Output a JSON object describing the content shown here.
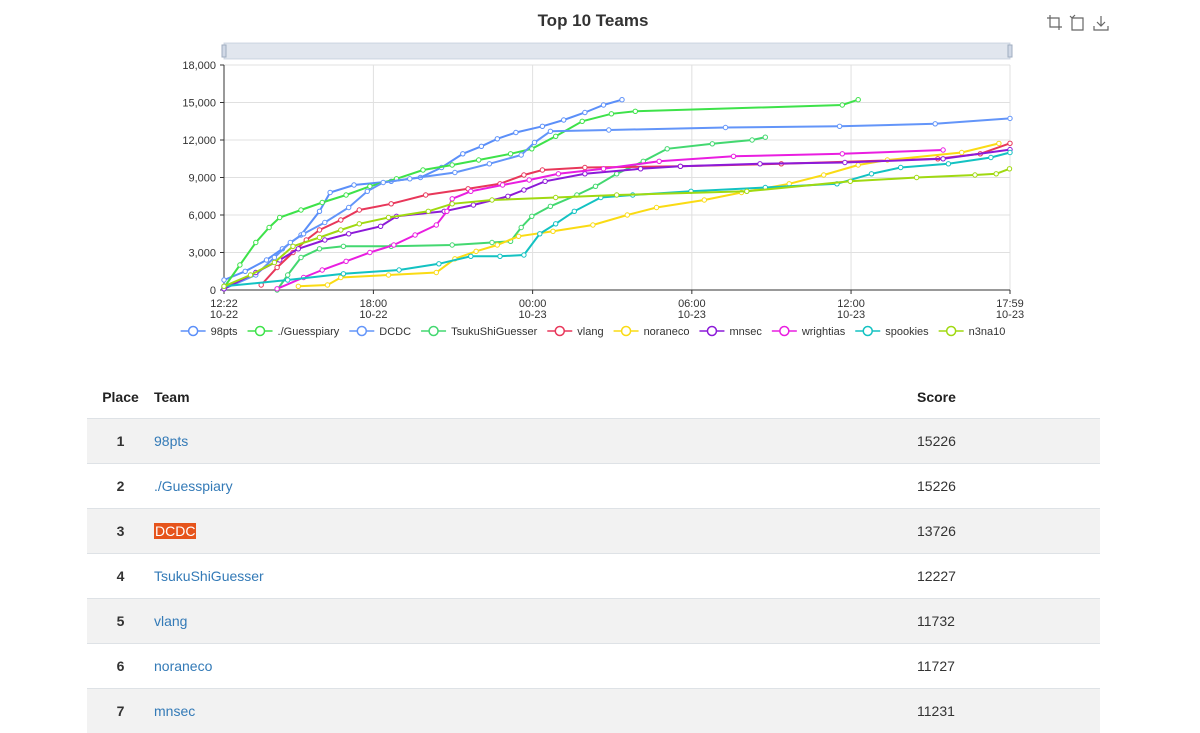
{
  "toolbar": {
    "zoom_icon": "zoom-icon",
    "zoom_reset_icon": "zoom-reset-icon",
    "download_icon": "download-icon"
  },
  "chart_data": {
    "type": "line",
    "title": "Top 10 Teams",
    "ylim": [
      0,
      18000
    ],
    "yticks": [
      0,
      3000,
      6000,
      9000,
      12000,
      15000,
      18000
    ],
    "ytick_labels": [
      "0",
      "3,000",
      "6,000",
      "9,000",
      "12,000",
      "15,000",
      "18,000"
    ],
    "xlim_hours": [
      0,
      29.62
    ],
    "xticks": [
      {
        "h": 0,
        "time": "12:22",
        "date": "10-22"
      },
      {
        "h": 5.63,
        "time": "18:00",
        "date": "10-22"
      },
      {
        "h": 11.63,
        "time": "00:00",
        "date": "10-23"
      },
      {
        "h": 17.63,
        "time": "06:00",
        "date": "10-23"
      },
      {
        "h": 23.63,
        "time": "12:00",
        "date": "10-23"
      },
      {
        "h": 29.62,
        "time": "17:59",
        "date": "10-23"
      }
    ],
    "grid": true,
    "legend_position": "bottom",
    "series": [
      {
        "name": "98pts",
        "color": "#5b8ff9",
        "points": [
          [
            0,
            800
          ],
          [
            0.8,
            1500
          ],
          [
            1.6,
            2400
          ],
          [
            2.2,
            3300
          ],
          [
            2.9,
            4400
          ],
          [
            3.6,
            6300
          ],
          [
            4,
            7800
          ],
          [
            4.9,
            8400
          ],
          [
            6.3,
            8700
          ],
          [
            7.4,
            9000
          ],
          [
            8.2,
            9800
          ],
          [
            9,
            10900
          ],
          [
            9.7,
            11500
          ],
          [
            10.3,
            12100
          ],
          [
            11,
            12600
          ],
          [
            12,
            13100
          ],
          [
            12.8,
            13600
          ],
          [
            13.6,
            14200
          ],
          [
            14.3,
            14800
          ],
          [
            15,
            15226
          ]
        ]
      },
      {
        "name": "./Guesspiary",
        "color": "#3ee24a",
        "points": [
          [
            0,
            200
          ],
          [
            0.6,
            2000
          ],
          [
            1.2,
            3800
          ],
          [
            1.7,
            5000
          ],
          [
            2.1,
            5800
          ],
          [
            2.9,
            6400
          ],
          [
            3.7,
            7000
          ],
          [
            4.6,
            7600
          ],
          [
            5.5,
            8300
          ],
          [
            6.5,
            8900
          ],
          [
            7.5,
            9600
          ],
          [
            8.6,
            10000
          ],
          [
            9.6,
            10400
          ],
          [
            10.8,
            10900
          ],
          [
            11.6,
            11300
          ],
          [
            12.5,
            12300
          ],
          [
            13.5,
            13500
          ],
          [
            14.6,
            14100
          ],
          [
            15.5,
            14300
          ],
          [
            23.3,
            14800
          ],
          [
            23.9,
            15226
          ]
        ]
      },
      {
        "name": "DCDC",
        "color": "#6395f9",
        "points": [
          [
            0,
            100
          ],
          [
            1.2,
            1200
          ],
          [
            1.9,
            2600
          ],
          [
            2.5,
            3800
          ],
          [
            3,
            4500
          ],
          [
            3.8,
            5400
          ],
          [
            4.7,
            6600
          ],
          [
            5.4,
            7900
          ],
          [
            6,
            8600
          ],
          [
            7,
            8900
          ],
          [
            8.7,
            9400
          ],
          [
            10,
            10100
          ],
          [
            11.2,
            10800
          ],
          [
            11.7,
            11800
          ],
          [
            12.3,
            12700
          ],
          [
            14.5,
            12800
          ],
          [
            18.9,
            13000
          ],
          [
            23.2,
            13100
          ],
          [
            26.8,
            13300
          ],
          [
            29.62,
            13726
          ]
        ]
      },
      {
        "name": "TsukuShiGuesser",
        "color": "#43d870",
        "points": [
          [
            2,
            0
          ],
          [
            2.4,
            1200
          ],
          [
            2.9,
            2600
          ],
          [
            3.6,
            3300
          ],
          [
            4.5,
            3500
          ],
          [
            6.3,
            3500
          ],
          [
            8.6,
            3600
          ],
          [
            10.1,
            3800
          ],
          [
            10.8,
            3900
          ],
          [
            11.2,
            5000
          ],
          [
            11.6,
            5900
          ],
          [
            12.3,
            6700
          ],
          [
            13.3,
            7600
          ],
          [
            14,
            8300
          ],
          [
            14.8,
            9300
          ],
          [
            15.8,
            10300
          ],
          [
            16.7,
            11300
          ],
          [
            18.4,
            11700
          ],
          [
            19.9,
            12000
          ],
          [
            20.4,
            12227
          ]
        ]
      },
      {
        "name": "vlang",
        "color": "#e8375a",
        "points": [
          [
            1.4,
            400
          ],
          [
            2,
            1800
          ],
          [
            2.6,
            3000
          ],
          [
            3.1,
            4000
          ],
          [
            3.6,
            4800
          ],
          [
            4.4,
            5600
          ],
          [
            5.1,
            6400
          ],
          [
            6.3,
            6900
          ],
          [
            7.6,
            7600
          ],
          [
            9.2,
            8100
          ],
          [
            10.4,
            8500
          ],
          [
            11.3,
            9200
          ],
          [
            12,
            9600
          ],
          [
            13.6,
            9800
          ],
          [
            17.2,
            9900
          ],
          [
            21,
            10100
          ],
          [
            26.9,
            10500
          ],
          [
            28.5,
            10900
          ],
          [
            29.62,
            11732
          ]
        ]
      },
      {
        "name": "noraneco",
        "color": "#fadb14",
        "points": [
          [
            2.8,
            300
          ],
          [
            3.9,
            400
          ],
          [
            4.4,
            1000
          ],
          [
            6.2,
            1200
          ],
          [
            8,
            1400
          ],
          [
            8.7,
            2500
          ],
          [
            9.5,
            3100
          ],
          [
            10.3,
            3600
          ],
          [
            11.1,
            4300
          ],
          [
            12.4,
            4700
          ],
          [
            13.9,
            5200
          ],
          [
            15.2,
            6000
          ],
          [
            16.3,
            6600
          ],
          [
            18.1,
            7200
          ],
          [
            19.5,
            7800
          ],
          [
            21.3,
            8500
          ],
          [
            22.6,
            9200
          ],
          [
            23.9,
            10000
          ],
          [
            25,
            10400
          ],
          [
            27.8,
            11000
          ],
          [
            29.2,
            11727
          ]
        ]
      },
      {
        "name": "mnsec",
        "color": "#8c1ad8",
        "points": [
          [
            0,
            100
          ],
          [
            1.2,
            1400
          ],
          [
            2.1,
            2400
          ],
          [
            2.8,
            3300
          ],
          [
            3.8,
            4000
          ],
          [
            4.7,
            4500
          ],
          [
            5.9,
            5100
          ],
          [
            6.5,
            5900
          ],
          [
            8.3,
            6300
          ],
          [
            9.4,
            6800
          ],
          [
            10.7,
            7500
          ],
          [
            11.3,
            8000
          ],
          [
            12.1,
            8700
          ],
          [
            13.6,
            9300
          ],
          [
            15.7,
            9700
          ],
          [
            17.2,
            9900
          ],
          [
            20.2,
            10100
          ],
          [
            23.4,
            10200
          ],
          [
            27.1,
            10500
          ],
          [
            29.62,
            11231
          ]
        ]
      },
      {
        "name": "wrightias",
        "color": "#e91ee0",
        "points": [
          [
            2,
            100
          ],
          [
            3,
            1000
          ],
          [
            3.7,
            1600
          ],
          [
            4.6,
            2300
          ],
          [
            5.5,
            3000
          ],
          [
            6.4,
            3600
          ],
          [
            7.2,
            4400
          ],
          [
            8,
            5200
          ],
          [
            8.4,
            6300
          ],
          [
            8.6,
            7300
          ],
          [
            9.3,
            7900
          ],
          [
            10.5,
            8400
          ],
          [
            11.5,
            8800
          ],
          [
            12.6,
            9300
          ],
          [
            14.3,
            9700
          ],
          [
            16.4,
            10300
          ],
          [
            19.2,
            10700
          ],
          [
            23.3,
            10900
          ],
          [
            27.1,
            11200
          ]
        ]
      },
      {
        "name": "spookies",
        "color": "#13c2c2",
        "points": [
          [
            0,
            300
          ],
          [
            2.4,
            800
          ],
          [
            4.5,
            1300
          ],
          [
            6.6,
            1600
          ],
          [
            8.1,
            2100
          ],
          [
            9.3,
            2700
          ],
          [
            10.4,
            2700
          ],
          [
            11.3,
            2800
          ],
          [
            11.9,
            4500
          ],
          [
            12.5,
            5300
          ],
          [
            13.2,
            6300
          ],
          [
            14.2,
            7400
          ],
          [
            15.4,
            7600
          ],
          [
            17.6,
            7900
          ],
          [
            20.4,
            8200
          ],
          [
            23.1,
            8500
          ],
          [
            24.4,
            9300
          ],
          [
            25.5,
            9800
          ],
          [
            27.3,
            10100
          ],
          [
            28.9,
            10600
          ],
          [
            29.62,
            11000
          ]
        ]
      },
      {
        "name": "n3na10",
        "color": "#a0d911",
        "points": [
          [
            0,
            300
          ],
          [
            1,
            1200
          ],
          [
            1.9,
            2200
          ],
          [
            2.6,
            3500
          ],
          [
            3.6,
            4200
          ],
          [
            4.4,
            4800
          ],
          [
            5.1,
            5300
          ],
          [
            6.2,
            5800
          ],
          [
            7.7,
            6300
          ],
          [
            8.6,
            6900
          ],
          [
            10.1,
            7200
          ],
          [
            12.5,
            7400
          ],
          [
            14.8,
            7600
          ],
          [
            19.7,
            7900
          ],
          [
            23.6,
            8700
          ],
          [
            26.1,
            9000
          ],
          [
            28.3,
            9200
          ],
          [
            29.1,
            9300
          ],
          [
            29.6,
            9700
          ]
        ]
      }
    ]
  },
  "table": {
    "headers": {
      "place": "Place",
      "team": "Team",
      "score": "Score"
    },
    "rows": [
      {
        "place": "1",
        "team": "98pts",
        "score": "15226"
      },
      {
        "place": "2",
        "team": "./Guesspiary",
        "score": "15226"
      },
      {
        "place": "3",
        "team": "DCDC",
        "score": "13726",
        "highlighted": true
      },
      {
        "place": "4",
        "team": "TsukuShiGuesser",
        "score": "12227"
      },
      {
        "place": "5",
        "team": "vlang",
        "score": "11732"
      },
      {
        "place": "6",
        "team": "noraneco",
        "score": "11727"
      },
      {
        "place": "7",
        "team": "mnsec",
        "score": "11231"
      }
    ]
  }
}
